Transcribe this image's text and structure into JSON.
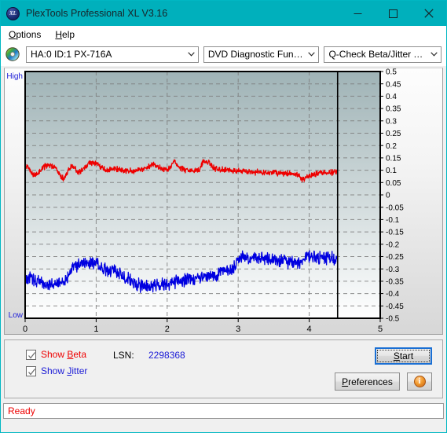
{
  "window": {
    "title": "PlexTools Professional XL V3.16",
    "icon": "xl-disc-icon",
    "minimize_label": "Minimize",
    "maximize_label": "Maximize",
    "close_label": "Close",
    "titlebar_color": "#00b0bc"
  },
  "menu": {
    "items": [
      {
        "label": "Options",
        "accel": "O"
      },
      {
        "label": "Help",
        "accel": "H"
      }
    ]
  },
  "toolbar": {
    "drive": {
      "value": "HA:0 ID:1  PX-716A"
    },
    "function": {
      "value": "DVD Diagnostic Functions"
    },
    "test": {
      "value": "Q-Check Beta/Jitter Test"
    }
  },
  "controls": {
    "show_beta": {
      "label": "Show Beta",
      "accel": "B",
      "checked": true,
      "color": "#ee0000"
    },
    "show_jitter": {
      "label": "Show Jitter",
      "accel": "J",
      "checked": true,
      "color": "#1a1ad6"
    },
    "lsn_label": "LSN:",
    "lsn_value": "2298368",
    "start_label": "Start",
    "start_accel": "S",
    "preferences_label": "Preferences",
    "preferences_accel": "P",
    "info_label": "i"
  },
  "status": {
    "text": "Ready",
    "color": "#ee0000"
  },
  "chart_data": {
    "type": "line",
    "title": "Q-Check Beta/Jitter Test",
    "xlabel": "",
    "ylabel": "",
    "xlim": [
      0,
      5
    ],
    "ylim": [
      -0.5,
      0.5
    ],
    "xticks": [
      "0",
      "1",
      "2",
      "3",
      "4",
      "5"
    ],
    "yticks": [
      "0.5",
      "0.45",
      "0.4",
      "0.35",
      "0.3",
      "0.25",
      "0.2",
      "0.15",
      "0.1",
      "0.05",
      "0",
      "-0.05",
      "-0.1",
      "-0.15",
      "-0.2",
      "-0.25",
      "-0.3",
      "-0.35",
      "-0.4",
      "-0.45",
      "-0.5"
    ],
    "left_axis_top_label": "High",
    "left_axis_bottom_label": "Low",
    "grid": true,
    "grid_style": "dashed",
    "legend": "none",
    "data_end_marker_x": 4.4,
    "plot_bg_gradient": [
      "#9fb3b6",
      "#ffffff"
    ],
    "series": [
      {
        "name": "Beta",
        "color": "#ee0000",
        "x": [
          0.0,
          0.05,
          0.1,
          0.15,
          0.2,
          0.25,
          0.3,
          0.35,
          0.4,
          0.45,
          0.5,
          0.55,
          0.6,
          0.65,
          0.7,
          0.75,
          0.8,
          0.85,
          0.9,
          0.95,
          1.0,
          1.05,
          1.1,
          1.15,
          1.2,
          1.25,
          1.3,
          1.35,
          1.4,
          1.45,
          1.5,
          1.55,
          1.6,
          1.65,
          1.7,
          1.75,
          1.8,
          1.85,
          1.9,
          1.95,
          2.0,
          2.05,
          2.1,
          2.15,
          2.2,
          2.25,
          2.3,
          2.35,
          2.4,
          2.45,
          2.5,
          2.55,
          2.6,
          2.65,
          2.7,
          2.75,
          2.8,
          2.85,
          2.9,
          2.95,
          3.0,
          3.05,
          3.1,
          3.15,
          3.2,
          3.25,
          3.3,
          3.35,
          3.4,
          3.45,
          3.5,
          3.55,
          3.6,
          3.65,
          3.7,
          3.75,
          3.8,
          3.85,
          3.9,
          3.95,
          4.0,
          4.05,
          4.1,
          4.15,
          4.2,
          4.25,
          4.3,
          4.35,
          4.4
        ],
        "values": [
          0.118,
          0.105,
          0.085,
          0.078,
          0.092,
          0.112,
          0.118,
          0.12,
          0.114,
          0.1,
          0.075,
          0.065,
          0.095,
          0.12,
          0.105,
          0.09,
          0.102,
          0.112,
          0.128,
          0.13,
          0.125,
          0.118,
          0.104,
          0.098,
          0.102,
          0.106,
          0.104,
          0.1,
          0.098,
          0.102,
          0.1,
          0.098,
          0.102,
          0.1,
          0.106,
          0.118,
          0.122,
          0.116,
          0.108,
          0.104,
          0.106,
          0.112,
          0.14,
          0.118,
          0.106,
          0.102,
          0.098,
          0.096,
          0.1,
          0.102,
          0.132,
          0.136,
          0.13,
          0.11,
          0.106,
          0.104,
          0.102,
          0.1,
          0.1,
          0.098,
          0.098,
          0.096,
          0.096,
          0.094,
          0.094,
          0.092,
          0.092,
          0.09,
          0.09,
          0.09,
          0.088,
          0.088,
          0.088,
          0.086,
          0.086,
          0.086,
          0.084,
          0.082,
          0.06,
          0.07,
          0.078,
          0.082,
          0.086,
          0.088,
          0.09,
          0.09,
          0.092,
          0.092,
          0.09
        ]
      },
      {
        "name": "Jitter",
        "color": "#0000e0",
        "x": [
          0.0,
          0.05,
          0.1,
          0.15,
          0.2,
          0.25,
          0.3,
          0.35,
          0.4,
          0.45,
          0.5,
          0.55,
          0.6,
          0.65,
          0.7,
          0.75,
          0.8,
          0.85,
          0.9,
          0.95,
          1.0,
          1.05,
          1.1,
          1.15,
          1.2,
          1.25,
          1.3,
          1.35,
          1.4,
          1.45,
          1.5,
          1.55,
          1.6,
          1.65,
          1.7,
          1.75,
          1.8,
          1.85,
          1.9,
          1.95,
          2.0,
          2.05,
          2.1,
          2.15,
          2.2,
          2.25,
          2.3,
          2.35,
          2.4,
          2.45,
          2.5,
          2.55,
          2.6,
          2.65,
          2.7,
          2.75,
          2.8,
          2.85,
          2.9,
          2.95,
          3.0,
          3.05,
          3.1,
          3.15,
          3.2,
          3.25,
          3.3,
          3.35,
          3.4,
          3.45,
          3.5,
          3.55,
          3.6,
          3.65,
          3.7,
          3.75,
          3.8,
          3.85,
          3.9,
          3.95,
          4.0,
          4.05,
          4.1,
          4.15,
          4.2,
          4.25,
          4.3,
          4.35,
          4.4
        ],
        "values": [
          -0.34,
          -0.33,
          -0.345,
          -0.35,
          -0.345,
          -0.365,
          -0.37,
          -0.368,
          -0.365,
          -0.36,
          -0.355,
          -0.35,
          -0.33,
          -0.3,
          -0.29,
          -0.285,
          -0.28,
          -0.272,
          -0.268,
          -0.272,
          -0.28,
          -0.29,
          -0.3,
          -0.305,
          -0.31,
          -0.308,
          -0.315,
          -0.32,
          -0.33,
          -0.34,
          -0.355,
          -0.36,
          -0.365,
          -0.37,
          -0.368,
          -0.37,
          -0.368,
          -0.365,
          -0.362,
          -0.36,
          -0.358,
          -0.355,
          -0.352,
          -0.35,
          -0.348,
          -0.345,
          -0.342,
          -0.34,
          -0.34,
          -0.338,
          -0.336,
          -0.334,
          -0.33,
          -0.325,
          -0.32,
          -0.315,
          -0.31,
          -0.305,
          -0.3,
          -0.295,
          -0.255,
          -0.25,
          -0.252,
          -0.255,
          -0.256,
          -0.258,
          -0.258,
          -0.26,
          -0.262,
          -0.262,
          -0.264,
          -0.266,
          -0.268,
          -0.27,
          -0.272,
          -0.274,
          -0.276,
          -0.272,
          -0.266,
          -0.258,
          -0.25,
          -0.252,
          -0.254,
          -0.256,
          -0.255,
          -0.254,
          -0.255,
          -0.256,
          -0.256
        ]
      }
    ]
  }
}
